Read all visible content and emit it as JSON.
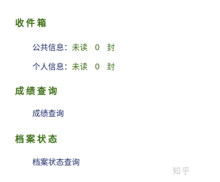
{
  "inbox": {
    "title": "收件箱",
    "public": {
      "label": "公共信息：",
      "status": "未读",
      "count": "0",
      "unit": "封"
    },
    "personal": {
      "label": "个人信息：",
      "status": "未读",
      "count": "0",
      "unit": "封"
    }
  },
  "grades": {
    "title": "成绩查询",
    "link": "成绩查询"
  },
  "archive": {
    "title": "档案状态",
    "link": "档案状态查询"
  },
  "watermark": "知乎"
}
